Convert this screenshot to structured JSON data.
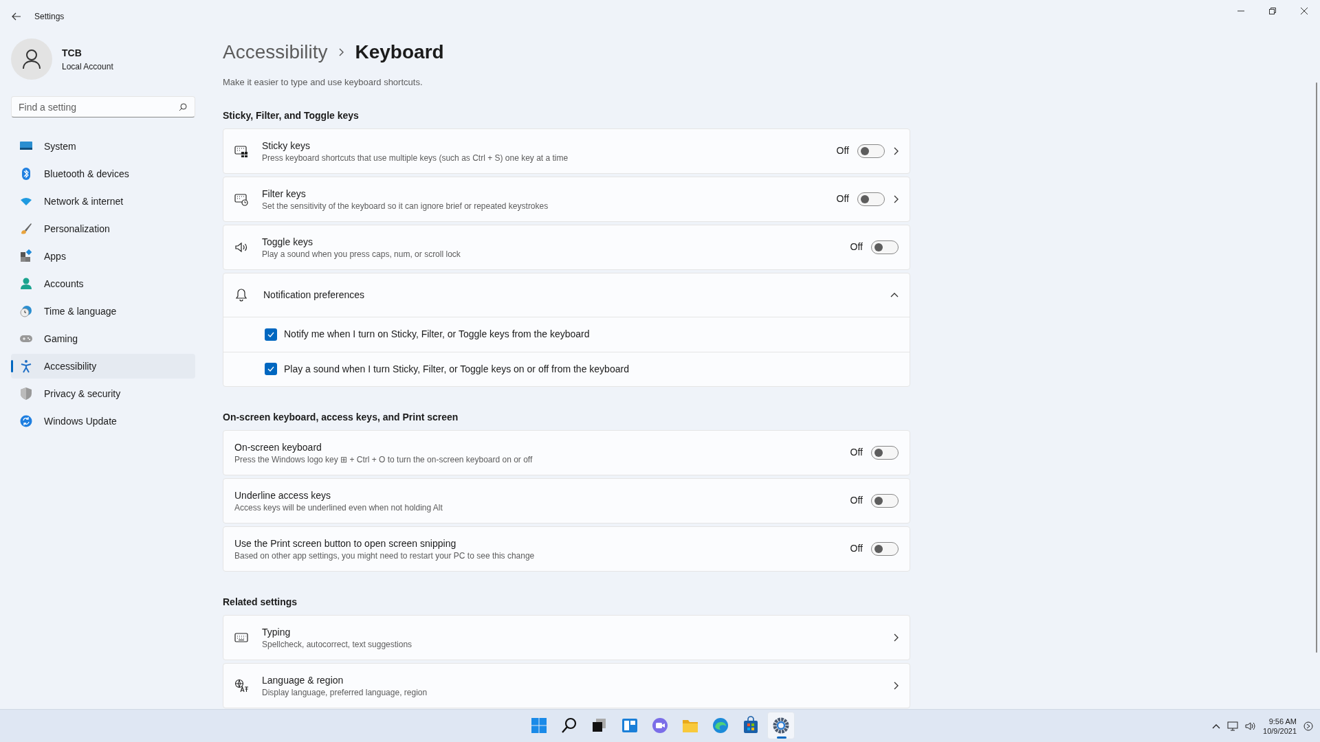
{
  "window": {
    "title": "Settings"
  },
  "account": {
    "name": "TCB",
    "type": "Local Account"
  },
  "search": {
    "placeholder": "Find a setting"
  },
  "sidebar": {
    "items": [
      {
        "label": "System",
        "selected": false
      },
      {
        "label": "Bluetooth & devices",
        "selected": false
      },
      {
        "label": "Network & internet",
        "selected": false
      },
      {
        "label": "Personalization",
        "selected": false
      },
      {
        "label": "Apps",
        "selected": false
      },
      {
        "label": "Accounts",
        "selected": false
      },
      {
        "label": "Time & language",
        "selected": false
      },
      {
        "label": "Gaming",
        "selected": false
      },
      {
        "label": "Accessibility",
        "selected": true
      },
      {
        "label": "Privacy & security",
        "selected": false
      },
      {
        "label": "Windows Update",
        "selected": false
      }
    ]
  },
  "breadcrumb": [
    "Accessibility",
    "Keyboard"
  ],
  "description": "Make it easier to type and use keyboard shortcuts.",
  "sections": [
    {
      "title": "Sticky, Filter, and Toggle keys",
      "rows": [
        {
          "kind": "toggle",
          "title": "Sticky keys",
          "subtitle": "Press keyboard shortcuts that use multiple keys (such as Ctrl + S) one key at a time",
          "state_label": "Off",
          "on": false,
          "chevron": true
        },
        {
          "kind": "toggle",
          "title": "Filter keys",
          "subtitle": "Set the sensitivity of the keyboard so it can ignore brief or repeated keystrokes",
          "state_label": "Off",
          "on": false,
          "chevron": true
        },
        {
          "kind": "toggle",
          "title": "Toggle keys",
          "subtitle": "Play a sound when you press caps, num, or scroll lock",
          "state_label": "Off",
          "on": false,
          "chevron": false
        },
        {
          "kind": "expander",
          "title": "Notification preferences",
          "expanded": true,
          "options": [
            {
              "label": "Notify me when I turn on Sticky, Filter, or Toggle keys from the keyboard",
              "checked": true
            },
            {
              "label": "Play a sound when I turn Sticky, Filter, or Toggle keys on or off from the keyboard",
              "checked": true
            }
          ]
        }
      ]
    },
    {
      "title": "On-screen keyboard, access keys, and Print screen",
      "rows": [
        {
          "kind": "toggle",
          "title": "On-screen keyboard",
          "subtitle": "Press the Windows logo key ⊞ + Ctrl + O to turn the on-screen keyboard on or off",
          "state_label": "Off",
          "on": false,
          "chevron": false
        },
        {
          "kind": "toggle",
          "title": "Underline access keys",
          "subtitle": "Access keys will be underlined even when not holding Alt",
          "state_label": "Off",
          "on": false,
          "chevron": false
        },
        {
          "kind": "toggle",
          "title": "Use the Print screen button to open screen snipping",
          "subtitle": "Based on other app settings, you might need to restart your PC to see this change",
          "state_label": "Off",
          "on": false,
          "chevron": false
        }
      ]
    },
    {
      "title": "Related settings",
      "rows": [
        {
          "kind": "link",
          "title": "Typing",
          "subtitle": "Spellcheck, autocorrect, text suggestions"
        },
        {
          "kind": "link",
          "title": "Language & region",
          "subtitle": "Display language, preferred language, region"
        }
      ]
    }
  ],
  "taskbar": {
    "apps": [
      {
        "selected": false
      },
      {
        "selected": false
      },
      {
        "selected": false
      },
      {
        "selected": false
      },
      {
        "selected": false
      },
      {
        "selected": false
      },
      {
        "selected": false
      },
      {
        "selected": false
      },
      {
        "selected": true
      }
    ],
    "time": "9:56 AM",
    "date": "10/9/2021"
  }
}
